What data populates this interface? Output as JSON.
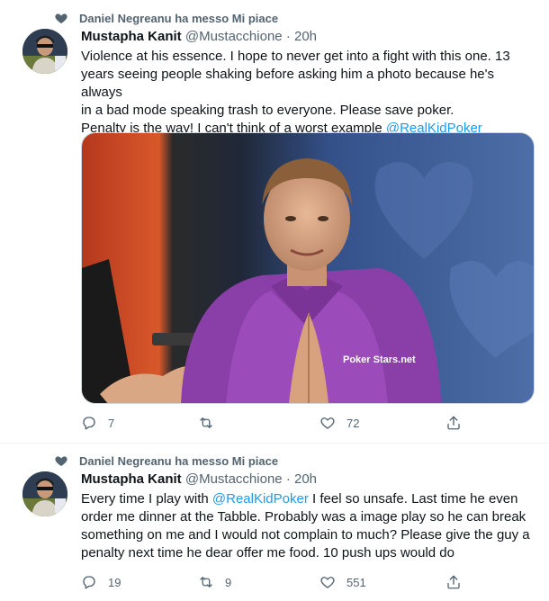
{
  "tweets": [
    {
      "social_context": "Daniel Negreanu ha messo Mi piace",
      "author_name": "Mustapha Kanit",
      "author_handle": "@Mustacchione",
      "time": "· 20h",
      "text_lines": [
        {
          "pre": "Violence at his essence. I hope to never get into a fight with this one. 13",
          "mention": "",
          "post": ""
        },
        {
          "pre": "years seeing people shaking before asking him a photo because he's always",
          "mention": "",
          "post": ""
        },
        {
          "pre": "in a bad mode speaking trash to everyone. Please save poker.",
          "mention": "",
          "post": ""
        },
        {
          "pre": "Penalty is the way! I can't think of a worst example ",
          "mention": "@RealKidPoker",
          "post": ""
        }
      ],
      "media_watermark": "Poker Stars.net",
      "replies": "7",
      "retweets": "",
      "likes": "72"
    },
    {
      "social_context": "Daniel Negreanu ha messo Mi piace",
      "author_name": "Mustapha Kanit",
      "author_handle": "@Mustacchione",
      "time": "· 20h",
      "text_lines": [
        {
          "pre": "Every time I play with ",
          "mention": "@RealKidPoker",
          "post": " I feel so unsafe. Last time he even"
        },
        {
          "pre": "order me dinner at the Tabble. Probably was a image play so he can break",
          "mention": "",
          "post": ""
        },
        {
          "pre": "something on me and I would not complain to much? Please give the guy a",
          "mention": "",
          "post": ""
        },
        {
          "pre": "penalty next time he dear offer me food.  10 push ups would do",
          "mention": "",
          "post": ""
        }
      ],
      "replies": "19",
      "retweets": "9",
      "likes": "551"
    }
  ],
  "colors": {
    "text": "#0f1419",
    "muted": "#536471",
    "link": "#1d9bf0",
    "border": "#eff3f4"
  },
  "icons": [
    "heart-icon",
    "reply-icon",
    "retweet-icon",
    "like-icon",
    "share-icon"
  ]
}
